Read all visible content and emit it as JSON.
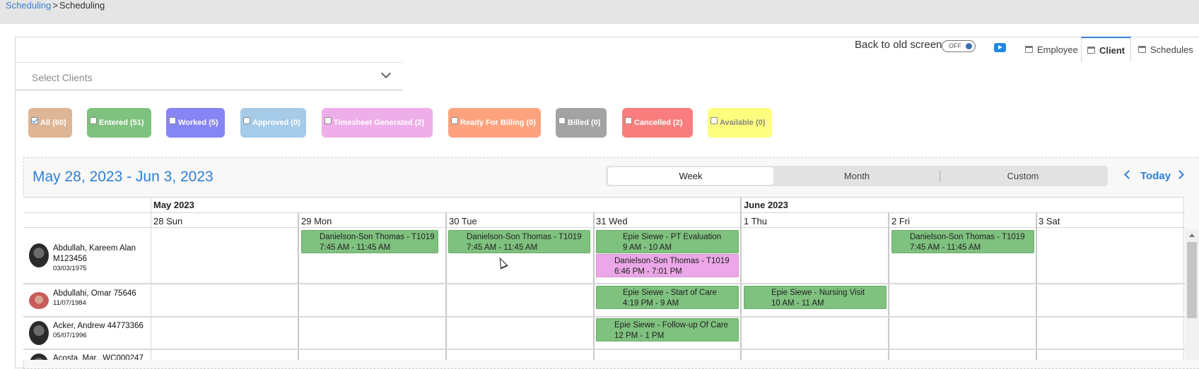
{
  "breadcrumb": {
    "parent": "Scheduling",
    "separator": ">",
    "current": "Scheduling"
  },
  "header": {
    "back_to_old": "Back to old screen",
    "toggle_state": "OFF",
    "tabs": [
      {
        "label": "Employee",
        "active": false
      },
      {
        "label": "Client",
        "active": true
      },
      {
        "label": "Schedules",
        "active": false
      }
    ]
  },
  "select_clients": {
    "placeholder": "Select Clients"
  },
  "filters": [
    {
      "label": "All (60)",
      "checked": true,
      "color": "#deb595"
    },
    {
      "label": "Entered (51)",
      "checked": false,
      "color": "#7fc17f"
    },
    {
      "label": "Worked (5)",
      "checked": false,
      "color": "#8585f5"
    },
    {
      "label": "Approved (0)",
      "checked": false,
      "color": "#a6cbe8"
    },
    {
      "label": "Timesheet Generated (2)",
      "checked": false,
      "color": "#eeaee9"
    },
    {
      "label": "Ready For Billing (0)",
      "checked": false,
      "color": "#fea27e"
    },
    {
      "label": "Billed (0)",
      "checked": false,
      "color": "#a3a3a3"
    },
    {
      "label": "Cancelled (2)",
      "checked": false,
      "color": "#fa7d7d"
    },
    {
      "label": "Available (0)",
      "checked": false,
      "color": "#fdfe7e"
    }
  ],
  "calendar": {
    "date_range": "May 28, 2023 - Jun 3, 2023",
    "views": [
      "Week",
      "Month",
      "Custom"
    ],
    "active_view": "Week",
    "today_label": "Today",
    "months": [
      "May 2023",
      "June 2023"
    ],
    "days": [
      "28 Sun",
      "29 Mon",
      "30 Tue",
      "31 Wed",
      "1 Thu",
      "2 Fri",
      "3 Sat"
    ],
    "clients": [
      {
        "name": "Abdullah, Kareem Alan",
        "id": "M123456",
        "dob": "03/03/1975"
      },
      {
        "name": "Abdullahi, Omar 75646",
        "id": "",
        "dob": "11/07/1984"
      },
      {
        "name": "Acker, Andrew 44773366",
        "id": "",
        "dob": "05/07/1996"
      },
      {
        "name": "Acosta, Mar...WC000247",
        "id": "",
        "dob": ""
      }
    ],
    "appointments": [
      {
        "row": 0,
        "day": 1,
        "title": "Danielson-Son Thomas - T1019",
        "time": "7:45 AM - 11:45 AM",
        "status": "green"
      },
      {
        "row": 0,
        "day": 2,
        "title": "Danielson-Son Thomas - T1019",
        "time": "7:45 AM - 11:45 AM",
        "status": "green"
      },
      {
        "row": 0,
        "day": 3,
        "title": "Epie Siewe - PT Evaluation",
        "time": "9 AM - 10 AM",
        "status": "green"
      },
      {
        "row": 0,
        "day": 3,
        "title": "Danielson-Son Thomas - T1019",
        "time": "6:46 PM - 7:01 PM",
        "status": "pink"
      },
      {
        "row": 0,
        "day": 5,
        "title": "Danielson-Son Thomas - T1019",
        "time": "7:45 AM - 11:45 AM",
        "status": "green"
      },
      {
        "row": 1,
        "day": 3,
        "title": "Epie Siewe - Start of Care",
        "time": "4:19 PM - 9 AM",
        "status": "green"
      },
      {
        "row": 1,
        "day": 4,
        "title": "Epie Siewe - Nursing Visit",
        "time": "10 AM - 11 AM",
        "status": "green"
      },
      {
        "row": 2,
        "day": 3,
        "title": "Epie Siewe - Follow-up Of Care",
        "time": "12 PM - 1 PM",
        "status": "green"
      }
    ]
  }
}
